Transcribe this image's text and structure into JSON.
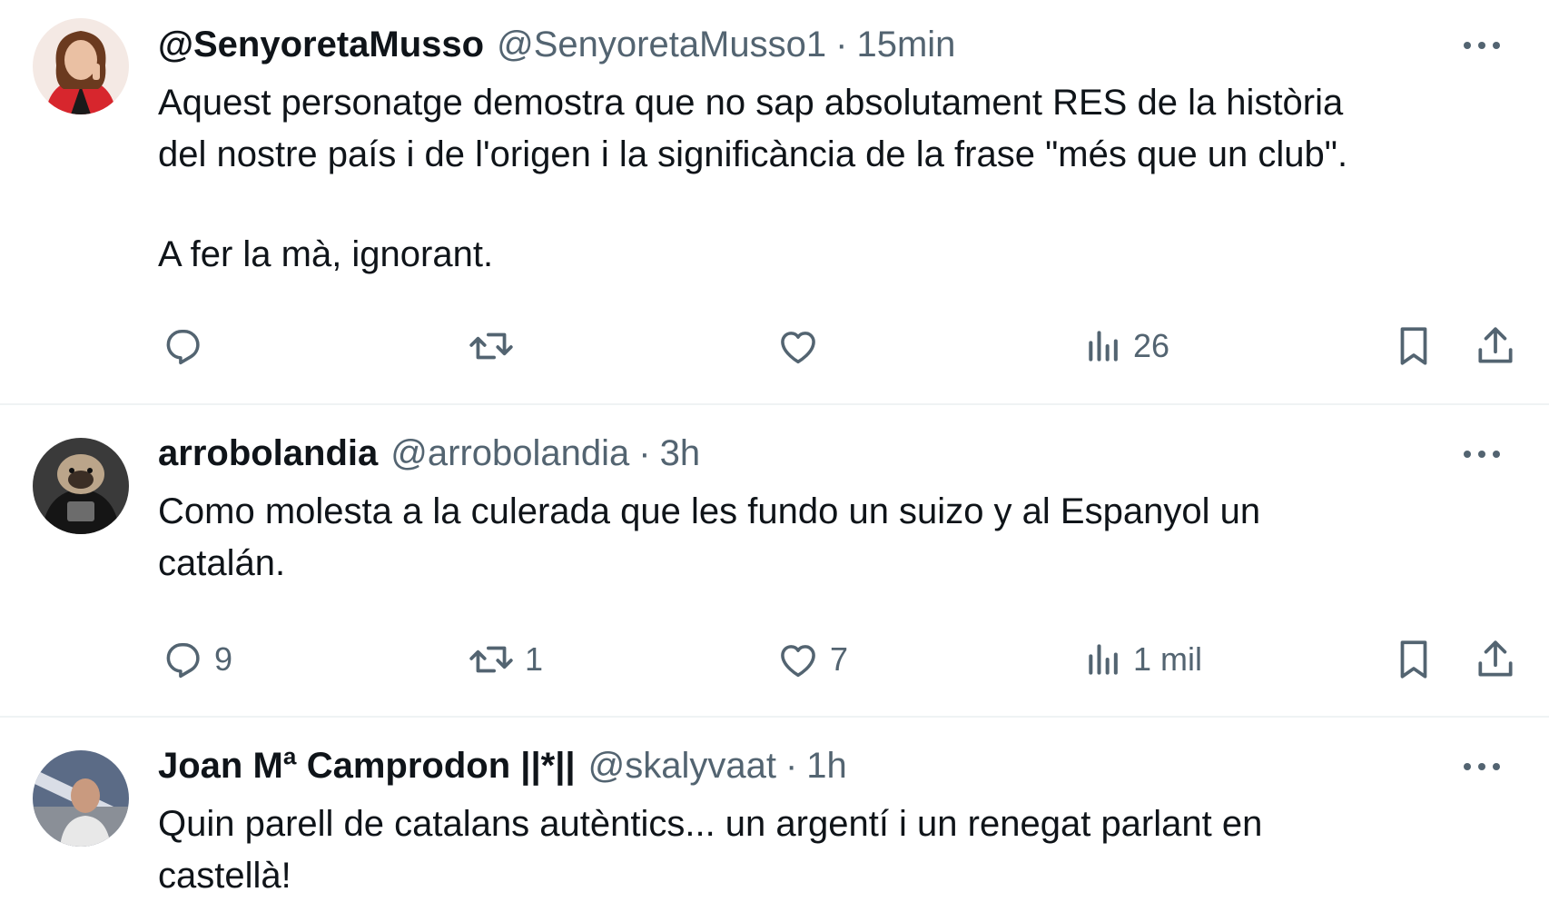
{
  "tweets": [
    {
      "name": "@SenyoretaMusso",
      "handle": "@SenyoretaMusso1",
      "separator": "·",
      "time": "15min",
      "text_line1": "Aquest personatge demostra que no sap absolutament RES de la història",
      "text_line2": "del nostre país i de l'origen i la significància de la frase \"més que un club\".",
      "text_line3": "A fer la mà, ignorant.",
      "replies": "",
      "retweets": "",
      "likes": "",
      "views": "26"
    },
    {
      "name": "arrobolandia",
      "handle": "@arrobolandia",
      "separator": "·",
      "time": "3h",
      "text_line1": "Como molesta a la culerada que les fundo un suizo y al Espanyol un",
      "text_line2": "catalán.",
      "replies": "9",
      "retweets": "1",
      "likes": "7",
      "views": "1 mil"
    },
    {
      "name": "Joan Mª Camprodon ||*||",
      "handle": "@skalyvaat",
      "separator": "·",
      "time": "1h",
      "text_line1": "Quin parell de catalans autèntics... un argentí i un renegat parlant en",
      "text_line2": "castellà!"
    }
  ],
  "icons": {
    "reply": "reply-icon",
    "retweet": "retweet-icon",
    "like": "like-icon",
    "views": "views-icon",
    "bookmark": "bookmark-icon",
    "share": "share-icon",
    "more": "more-icon"
  },
  "colors": {
    "text": "#0f1419",
    "secondary": "#536471",
    "divider": "#eff3f4"
  }
}
